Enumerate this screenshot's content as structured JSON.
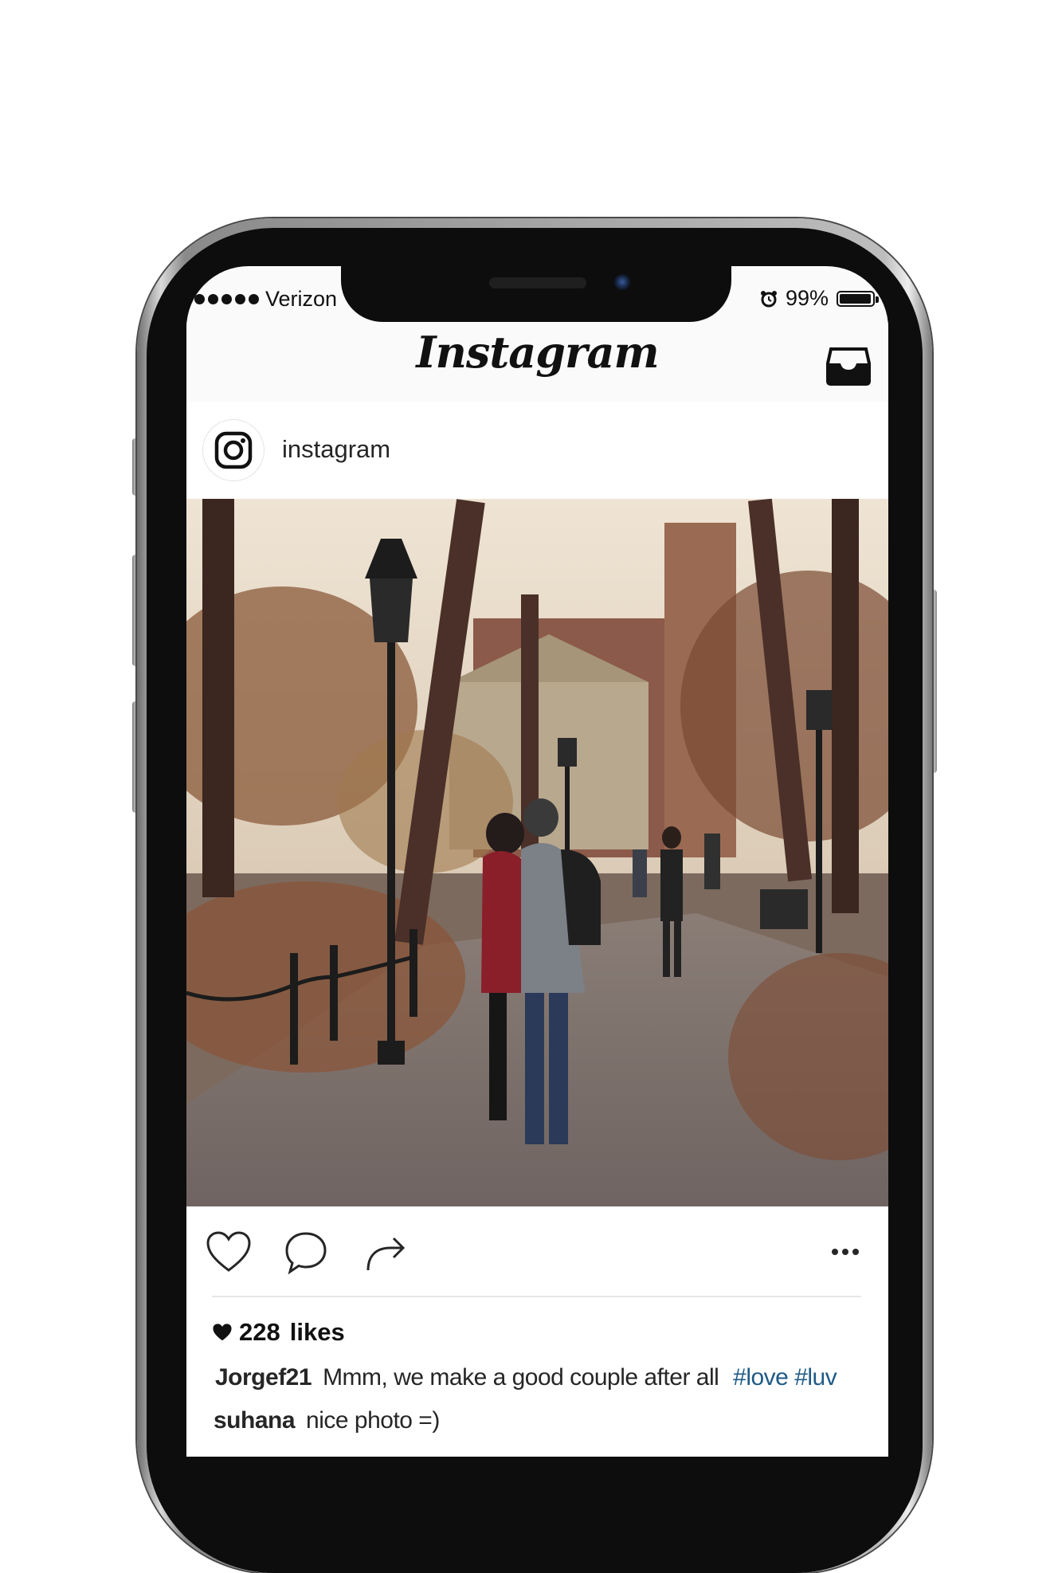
{
  "status_bar": {
    "carrier": "Verizon",
    "battery": "99%"
  },
  "header": {
    "logo_text": "Instagram",
    "inbox_icon": "inbox-tray-icon"
  },
  "post": {
    "username": "instagram",
    "avatar_icon": "instagram-camera-logo-icon",
    "photo_description_icon": "photo",
    "likes_count": "228",
    "likes_label": "likes",
    "caption": {
      "user": "Jorgef21",
      "text": "Mmm, we make a good couple after all",
      "hashtags": [
        "#love",
        "#luv"
      ]
    },
    "comments": [
      {
        "user": "suhana",
        "text": "nice photo =)"
      }
    ]
  },
  "colors": {
    "hashtag": "#1f5a86",
    "text": "#262626",
    "background": "#fafafa"
  }
}
